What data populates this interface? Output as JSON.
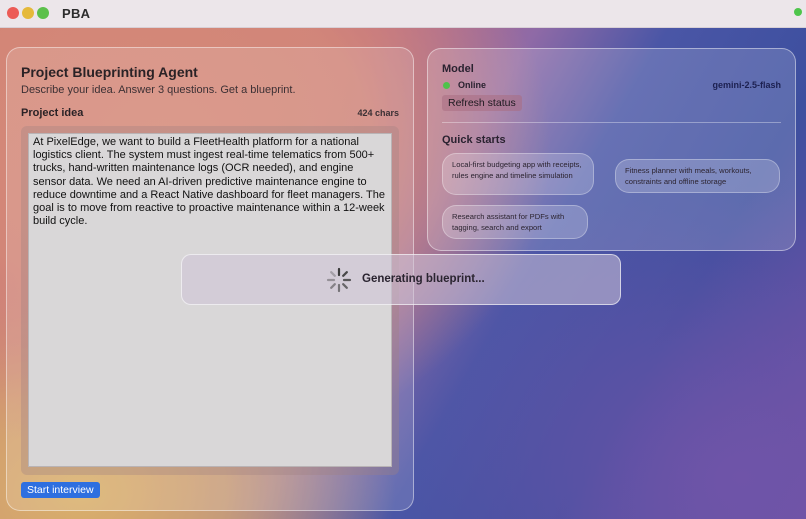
{
  "window": {
    "title": "PBA"
  },
  "left_panel": {
    "title": "Project Blueprinting Agent",
    "subtitle": "Describe your idea. Answer 3 questions. Get a blueprint.",
    "idea_label": "Project idea",
    "char_count": "424 chars",
    "idea_text": "At PixelEdge, we want to build a FleetHealth platform for a national logistics client. The system must ingest real-time telematics from 500+ trucks, hand-written maintenance logs (OCR needed), and engine sensor data. We need an AI-driven predictive maintenance engine to reduce downtime and a React Native dashboard for fleet managers. The goal is to move from reactive to proactive maintenance within a 12-week build cycle.",
    "start_button": "Start interview"
  },
  "right_panel": {
    "model_heading": "Model",
    "status": "Online",
    "model_name": "gemini-2.5-flash",
    "refresh_button": "Refresh status",
    "quick_starts_heading": "Quick starts",
    "quick_starts": [
      {
        "label": "Local-first budgeting app with receipts, rules engine and timeline simulation"
      },
      {
        "label": "Fitness planner with meals, workouts, constraints and offline storage"
      },
      {
        "label": "Research assistant for PDFs with tagging, search and export"
      }
    ]
  },
  "overlay": {
    "message": "Generating blueprint..."
  },
  "colors": {
    "online": "#4fc24a",
    "primary_button": "#2e6fe0"
  }
}
